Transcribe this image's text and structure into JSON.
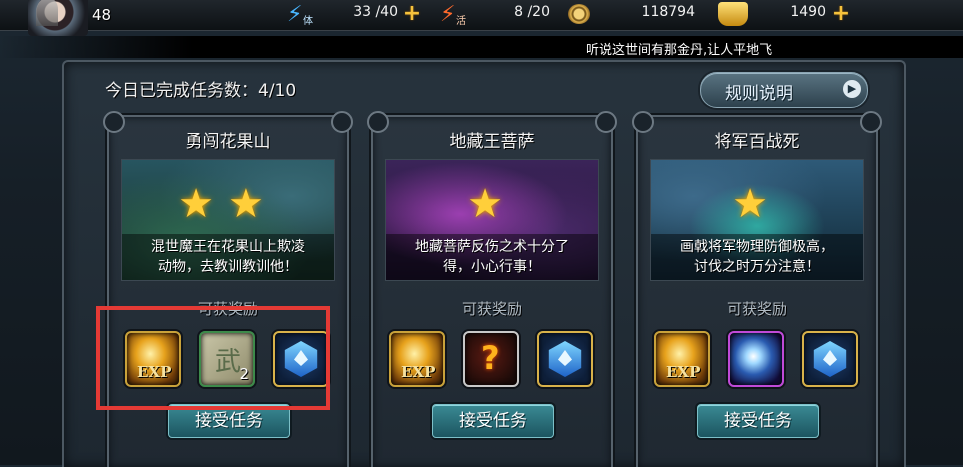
{
  "topbar": {
    "level": "48",
    "stamina": {
      "label": "体",
      "value": "33 /40",
      "icon": "stamina-bolt-icon"
    },
    "vigor": {
      "label": "活",
      "value": "8 /20",
      "icon": "vigor-bolt-icon"
    },
    "coins": {
      "value": "118794",
      "icon": "coin-icon"
    },
    "gold": {
      "value": "1490",
      "icon": "gold-ingot-icon"
    },
    "plus": "+"
  },
  "ticker": {
    "text": "听说这世间有那金丹,让人平地飞"
  },
  "main": {
    "progress_text": "今日已完成任务数：4/10",
    "rules_button": "规则说明",
    "rules_arrow": "▶",
    "reward_label": "可获奖励",
    "accept_label": "接受任务",
    "stars_glyph": "★"
  },
  "missions": [
    {
      "title": "勇闯花果山",
      "stars": 2,
      "desc_line1": "混世魔王在花果山上欺凌",
      "desc_line2": "动物，去教训教训他！",
      "rewards": [
        {
          "type": "exp",
          "label": "EXP"
        },
        {
          "type": "scroll",
          "glyph": "武",
          "qty": "2"
        },
        {
          "type": "gem"
        }
      ]
    },
    {
      "title": "地藏王菩萨",
      "stars": 1,
      "desc_line1": "地藏菩萨反伤之术十分了",
      "desc_line2": "得，小心行事！",
      "rewards": [
        {
          "type": "exp",
          "label": "EXP"
        },
        {
          "type": "mystery",
          "glyph": "?"
        },
        {
          "type": "gem"
        }
      ]
    },
    {
      "title": "将军百战死",
      "stars": 1,
      "desc_line1": "画戟将军物理防御极高，",
      "desc_line2": "讨伐之时万分注意！",
      "rewards": [
        {
          "type": "exp",
          "label": "EXP"
        },
        {
          "type": "orb"
        },
        {
          "type": "gem"
        }
      ]
    }
  ],
  "colors": {
    "star": "#ffcf3a",
    "plus": "#f6c23c",
    "highlight": "#e53a35",
    "accept_button": "#2a7480"
  }
}
